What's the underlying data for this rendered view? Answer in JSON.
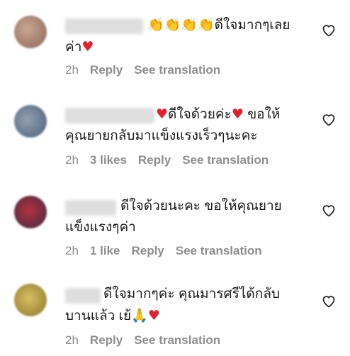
{
  "comments": [
    {
      "text_line1": "ดีใจมากๆเลย",
      "text_line2": "ค่า",
      "time": "2h",
      "likes": "",
      "reply": "Reply",
      "translate": "See translation",
      "avatar_color": "#b38e7a"
    },
    {
      "text_line1a": "ดีใจด้วยค่ะ",
      "text_line1b": "ขอให้",
      "text_line2": "คุณยายกลับมาแข็งแรงเร็วๆนะคะ",
      "time": "2h",
      "likes": "3 likes",
      "reply": "Reply",
      "translate": "See translation",
      "avatar_color": "#6f7e94"
    },
    {
      "text_line1": "ดีใจด้วยนะคะ ขอให้คุณยาย",
      "text_line2": "แข็งแรงๆค่า",
      "time": "2h",
      "likes": "1 like",
      "reply": "Reply",
      "translate": "See translation",
      "avatar_color": "#7a2b35"
    },
    {
      "text_line1": "ดีใจมากๆค่ะ คุณมารศรีได้กลับ",
      "text_line2": "บานแล้ว เย้",
      "time": "2h",
      "likes": "",
      "reply": "Reply",
      "translate": "See translation",
      "avatar_color": "#b9a13f"
    }
  ],
  "icons": {
    "heart": "heart-icon",
    "clap": "clapping-hands-icon",
    "pray": "folded-hands-icon",
    "like": "heart-outline-icon"
  },
  "colors": {
    "heart_emoji": "#e0202e",
    "meta_text": "#8e8e8e"
  }
}
